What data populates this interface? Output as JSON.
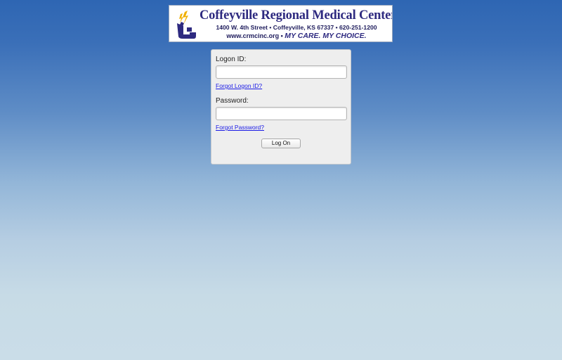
{
  "banner": {
    "org_name": "Coffeyville Regional Medical Center",
    "address": "1400 W. 4th Street • Coffeyville, KS 67337 • 620-251-1200",
    "website": "www.crmcinc.org",
    "separator": " • ",
    "tagline": "MY CARE. MY CHOICE.",
    "logo_icon": "crmc-logo-icon",
    "brand_color": "#2e2a80"
  },
  "login": {
    "logon_id_label": "Logon ID:",
    "logon_id_value": "",
    "forgot_logon_link": "Forgot Logon ID?",
    "password_label": "Password:",
    "password_value": "",
    "forgot_password_link": "Forgot Password?",
    "logon_button": "Log On"
  },
  "colors": {
    "background_top": "#2e66b3",
    "background_bottom": "#cadde8",
    "panel": "#eeeeee",
    "link": "#1a1ae6"
  }
}
